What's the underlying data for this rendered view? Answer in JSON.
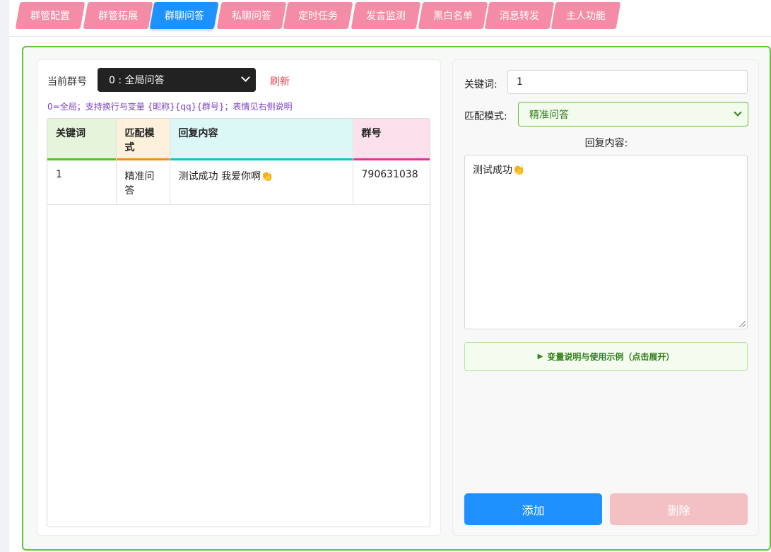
{
  "tabs": [
    {
      "label": "群管配置",
      "active": false
    },
    {
      "label": "群管拓展",
      "active": false
    },
    {
      "label": "群聊问答",
      "active": true
    },
    {
      "label": "私聊问答",
      "active": false
    },
    {
      "label": "定时任务",
      "active": false
    },
    {
      "label": "发言监测",
      "active": false
    },
    {
      "label": "黑白名单",
      "active": false
    },
    {
      "label": "消息转发",
      "active": false
    },
    {
      "label": "主人功能",
      "active": false
    }
  ],
  "left": {
    "group_label": "当前群号",
    "group_select": "0 : 全局问答",
    "refresh": "刷新",
    "hint": "0=全局；支持换行与变量 {昵称}{qq}{群号}；表情见右侧说明"
  },
  "table": {
    "columns": [
      {
        "label": "关键词",
        "bg": "#e6f4dc",
        "accent": "#52c41a"
      },
      {
        "label": "匹配模式",
        "bg": "#fdf1dc",
        "accent": "#fa8c16"
      },
      {
        "label": "回复内容",
        "bg": "#dcf8f6",
        "accent": "#13c2c2"
      },
      {
        "label": "群号",
        "bg": "#fce1ec",
        "accent": "#eb2f96"
      }
    ],
    "rows": [
      {
        "keyword": "1",
        "mode": "精准问答",
        "reply": "测试成功 我爱你啊👏",
        "group": "790631038"
      }
    ]
  },
  "right": {
    "keyword_label": "关键词:",
    "keyword_value": "1",
    "mode_label": "匹配模式:",
    "mode_value": "精准问答",
    "reply_label": "回复内容:",
    "reply_value": "测试成功👏",
    "expander": "变量说明与使用示例（点击展开）",
    "add_button": "添加",
    "delete_button": "删除"
  },
  "colors": {
    "tab": "#f48ca7",
    "tab_active": "#1e90ff",
    "frame_border": "#67c23a",
    "refresh": "#e5484d",
    "hint": "#7b3fc4",
    "add": "#1e90ff",
    "delete": "#f3c0c3"
  }
}
